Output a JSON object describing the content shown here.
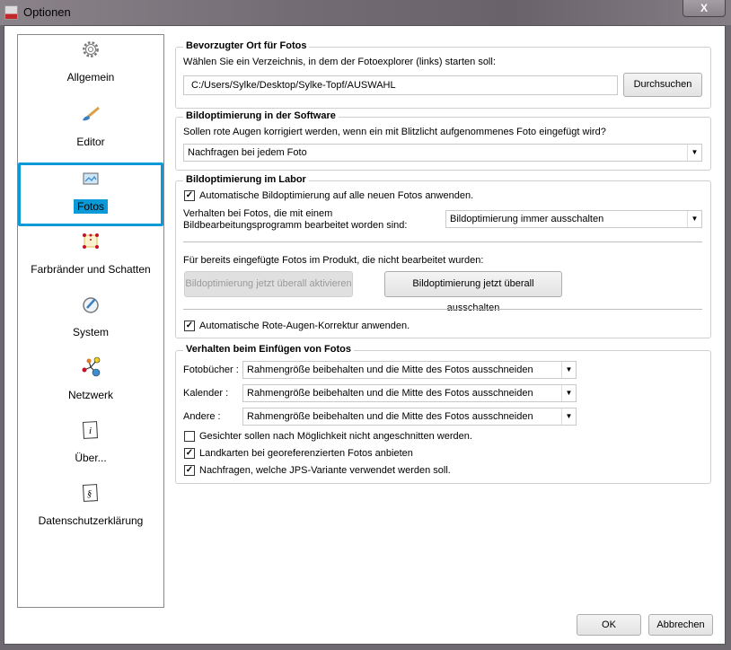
{
  "window": {
    "title": "Optionen",
    "close_label": "X"
  },
  "sidebar": {
    "items": [
      {
        "label": "Allgemein",
        "icon": "gear-icon"
      },
      {
        "label": "Editor",
        "icon": "brush-icon"
      },
      {
        "label": "Fotos",
        "icon": "image-icon",
        "selected": true
      },
      {
        "label": "Farbränder und Schatten",
        "icon": "frame-icon"
      },
      {
        "label": "System",
        "icon": "system-icon"
      },
      {
        "label": "Netzwerk",
        "icon": "network-icon"
      },
      {
        "label": "Über...",
        "icon": "info-icon"
      },
      {
        "label": "Datenschutzerklärung",
        "icon": "paragraph-icon"
      }
    ]
  },
  "location": {
    "title": "Bevorzugter Ort für Fotos",
    "desc": "Wählen Sie ein Verzeichnis, in dem der Fotoexplorer (links) starten soll:",
    "path": "C:/Users/Sylke/Desktop/Sylke-Topf/AUSWAHL",
    "browse": "Durchsuchen"
  },
  "software": {
    "title": "Bildoptimierung in der Software",
    "desc": "Sollen rote Augen korrigiert werden, wenn ein mit Blitzlicht aufgenommenes Foto eingefügt wird?",
    "value": "Nachfragen bei jedem Foto"
  },
  "labor": {
    "title": "Bildoptimierung im Labor",
    "auto_label": "Automatische Bildoptimierung auf alle neuen Fotos anwenden.",
    "auto_checked": true,
    "behavior_line1": "Verhalten bei Fotos, die mit einem",
    "behavior_line2": "Bildbearbeitungsprogramm bearbeitet worden sind:",
    "behavior_value": "Bildoptimierung immer ausschalten",
    "existing_label": "Für bereits eingefügte Fotos im Produkt, die nicht bearbeitet wurden:",
    "activate_btn": "Bildoptimierung jetzt überall aktivieren",
    "deactivate_btn": "Bildoptimierung jetzt überall ausschalten",
    "redeye_label": "Automatische Rote-Augen-Korrektur anwenden.",
    "redeye_checked": true
  },
  "insert": {
    "title": "Verhalten beim Einfügen von Fotos",
    "rows": [
      {
        "label": "Fotobücher :",
        "value": "Rahmengröße beibehalten und die Mitte des Fotos ausschneiden"
      },
      {
        "label": "Kalender :",
        "value": "Rahmengröße beibehalten und die Mitte des Fotos ausschneiden"
      },
      {
        "label": "Andere :",
        "value": "Rahmengröße beibehalten und die Mitte des Fotos ausschneiden"
      }
    ],
    "checks": [
      {
        "label": "Gesichter sollen nach Möglichkeit nicht angeschnitten werden.",
        "checked": false
      },
      {
        "label": "Landkarten bei georeferenzierten Fotos anbieten",
        "checked": true
      },
      {
        "label": "Nachfragen, welche JPS-Variante verwendet werden soll.",
        "checked": true
      }
    ]
  },
  "footer": {
    "ok": "OK",
    "cancel": "Abbrechen"
  }
}
